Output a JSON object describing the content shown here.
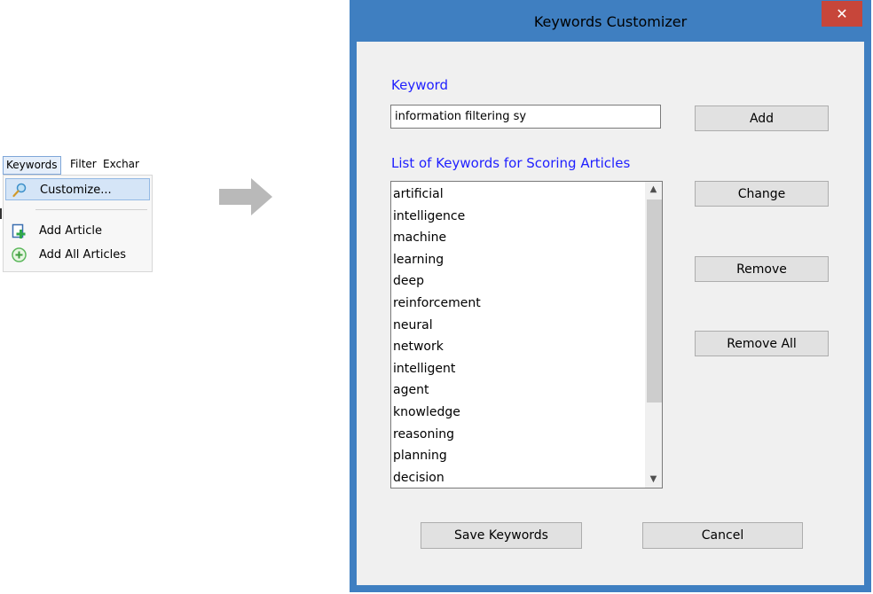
{
  "menu": {
    "bar_items": [
      "Keywords",
      "Filter",
      "Exchar"
    ],
    "items": [
      {
        "label": "Customize...",
        "icon": "search-wand-icon"
      },
      {
        "label": "Add Article",
        "icon": "add-document-icon"
      },
      {
        "label": "Add All Articles",
        "icon": "add-circle-icon"
      }
    ]
  },
  "dialog": {
    "title": "Keywords Customizer",
    "close_label": "✕",
    "keyword_label": "Keyword",
    "keyword_value": "information filtering sy",
    "list_label": "List of Keywords for Scoring Articles",
    "keywords": [
      "artificial",
      "intelligence",
      "machine",
      "learning",
      "deep",
      "reinforcement",
      "neural",
      "network",
      "intelligent",
      "agent",
      "knowledge",
      "reasoning",
      "planning",
      "decision"
    ],
    "buttons": {
      "add": "Add",
      "change": "Change",
      "remove": "Remove",
      "remove_all": "Remove All",
      "save": "Save Keywords",
      "cancel": "Cancel"
    }
  },
  "colors": {
    "frame": "#3f7fc1",
    "close": "#c7463a",
    "label_blue": "#1f1fff",
    "client": "#f0f0f0"
  }
}
